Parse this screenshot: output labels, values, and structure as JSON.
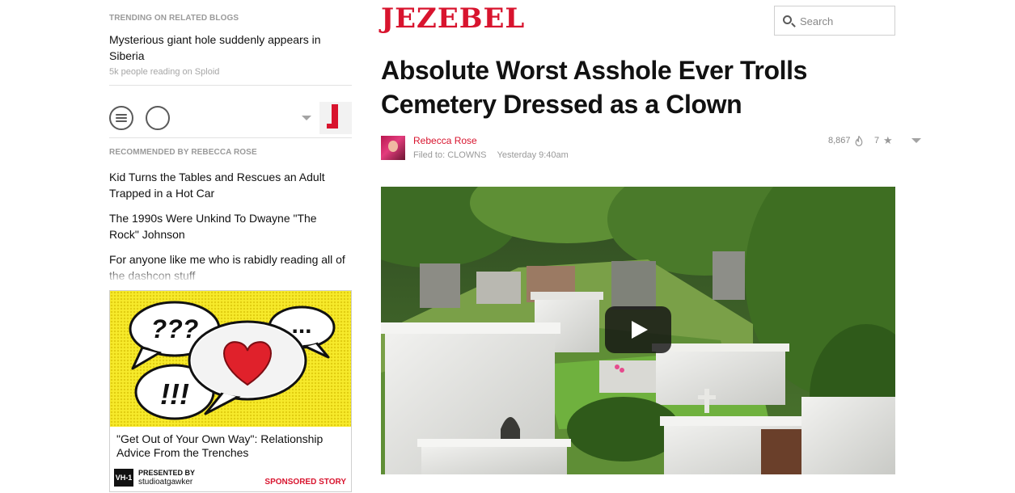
{
  "brand": {
    "name": "JEZEBEL",
    "color": "#d8142e"
  },
  "search": {
    "placeholder": "Search"
  },
  "sidebar": {
    "trending": {
      "label": "TRENDING ON RELATED BLOGS",
      "title": "Mysterious giant hole suddenly appears in Siberia",
      "meta": "5k people reading on Sploid"
    },
    "controls": {
      "menu_icon": "menu-icon",
      "blog_logo_letter": "J"
    },
    "recommended": {
      "label": "RECOMMENDED BY REBECCA ROSE",
      "items": [
        "Kid Turns the Tables and Rescues an Adult Trapped in a Hot Car",
        "The 1990s Were Unkind To Dwayne \"The Rock\" Johnson",
        "For anyone like me who is rabidly reading all of the dashcon stuff"
      ]
    },
    "ad": {
      "title": "\"Get Out of Your Own Way\": Relationship Advice From the Trenches",
      "logo_text": "VH-1",
      "presented_label": "PRESENTED BY",
      "sponsor": "studioatgawker",
      "sponsored_label": "SPONSORED STORY",
      "bubble_texts": [
        "???",
        "...",
        "!!!"
      ]
    }
  },
  "article": {
    "headline": "Absolute Worst Asshole Ever Trolls Cemetery Dressed as a Clown",
    "author": "Rebecca Rose",
    "filed_label": "Filed to:",
    "filed_tag": "CLOWNS",
    "timestamp": "Yesterday 9:40am",
    "views": "8,867",
    "stars": "7",
    "star_glyph": "★"
  }
}
